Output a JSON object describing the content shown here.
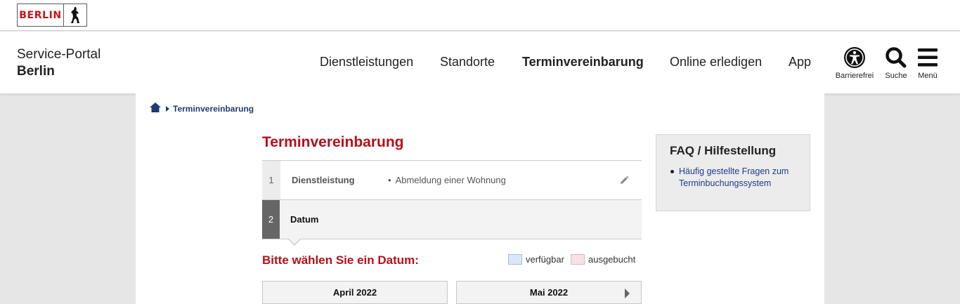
{
  "topbar": {
    "logo_text": "BERLIN"
  },
  "header": {
    "portal_line1": "Service-Portal",
    "portal_line2": "Berlin",
    "nav": [
      {
        "label": "Dienstleistungen"
      },
      {
        "label": "Standorte"
      },
      {
        "label": "Terminvereinbarung",
        "active": true
      },
      {
        "label": "Online erledigen"
      },
      {
        "label": "App"
      }
    ],
    "tools": {
      "accessibility": "Barrierefrei",
      "search": "Suche",
      "menu": "Menü"
    }
  },
  "breadcrumb": {
    "current": "Terminvereinbarung"
  },
  "main": {
    "title": "Terminvereinbarung",
    "steps": [
      {
        "number": "1",
        "label": "Dienstleistung",
        "value": "Abmeldung einer Wohnung"
      },
      {
        "number": "2",
        "label": "Datum"
      }
    ],
    "choose_date": "Bitte wählen Sie ein Datum:",
    "legend": {
      "available": "verfügbar",
      "booked": "ausgebucht"
    },
    "months": [
      "April 2022",
      "Mai 2022"
    ]
  },
  "faq": {
    "title": "FAQ / Hilfestellung",
    "link": "Häufig gestellte Fragen zum Terminbuchungssystem"
  },
  "colors": {
    "brand_red": "#c4121c",
    "heading_red": "#b4101a",
    "link_blue": "#1e3c8c",
    "available_swatch": "#dde6f6",
    "booked_swatch": "#f6e2e4"
  }
}
